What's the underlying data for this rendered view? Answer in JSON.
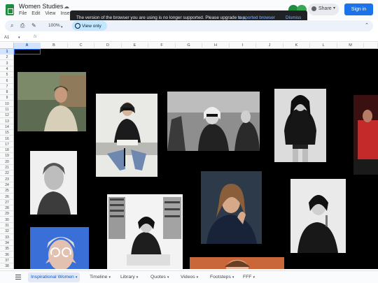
{
  "app": {
    "doc_title": "Women Studies",
    "menu": [
      "File",
      "Edit",
      "View",
      "Insert"
    ]
  },
  "notification": {
    "message": "The version of the browser you are using is no longer supported. Please upgrade to a",
    "link_text": "supported browser",
    "suffix": ".",
    "dismiss_label": "Dismiss"
  },
  "header": {
    "share_label": "Share",
    "signin_label": "Sign in"
  },
  "toolbar": {
    "zoom": "100%",
    "mode_label": "View only"
  },
  "formula_bar": {
    "cell_ref": "A1",
    "fx_label": "fx"
  },
  "grid": {
    "columns": [
      "A",
      "B",
      "C",
      "D",
      "E",
      "F",
      "G",
      "H",
      "I",
      "J",
      "K",
      "L",
      "M"
    ],
    "rows": [
      "1",
      "2",
      "3",
      "4",
      "5",
      "6",
      "7",
      "8",
      "9",
      "10",
      "11",
      "12",
      "13",
      "14",
      "15",
      "16",
      "17",
      "18",
      "19",
      "20",
      "21",
      "22",
      "23",
      "24",
      "25",
      "26",
      "27",
      "28",
      "29",
      "30",
      "31",
      "32",
      "33",
      "34",
      "35",
      "36",
      "37",
      "38"
    ],
    "selected_cell": "A1",
    "background": "#000000"
  },
  "sheet_tabs": [
    {
      "label": "Inspirational Women",
      "active": true
    },
    {
      "label": "Timeline",
      "active": false
    },
    {
      "label": "Library",
      "active": false
    },
    {
      "label": "Quotes",
      "active": false
    },
    {
      "label": "Videos",
      "active": false
    },
    {
      "label": "Footsteps",
      "active": false
    },
    {
      "label": "FFF",
      "active": false
    }
  ],
  "colors": {
    "accent": "#1a73e8",
    "brand": "#1e8e3e",
    "toast_bg": "#202124",
    "toast_link": "#8ab4f8"
  }
}
